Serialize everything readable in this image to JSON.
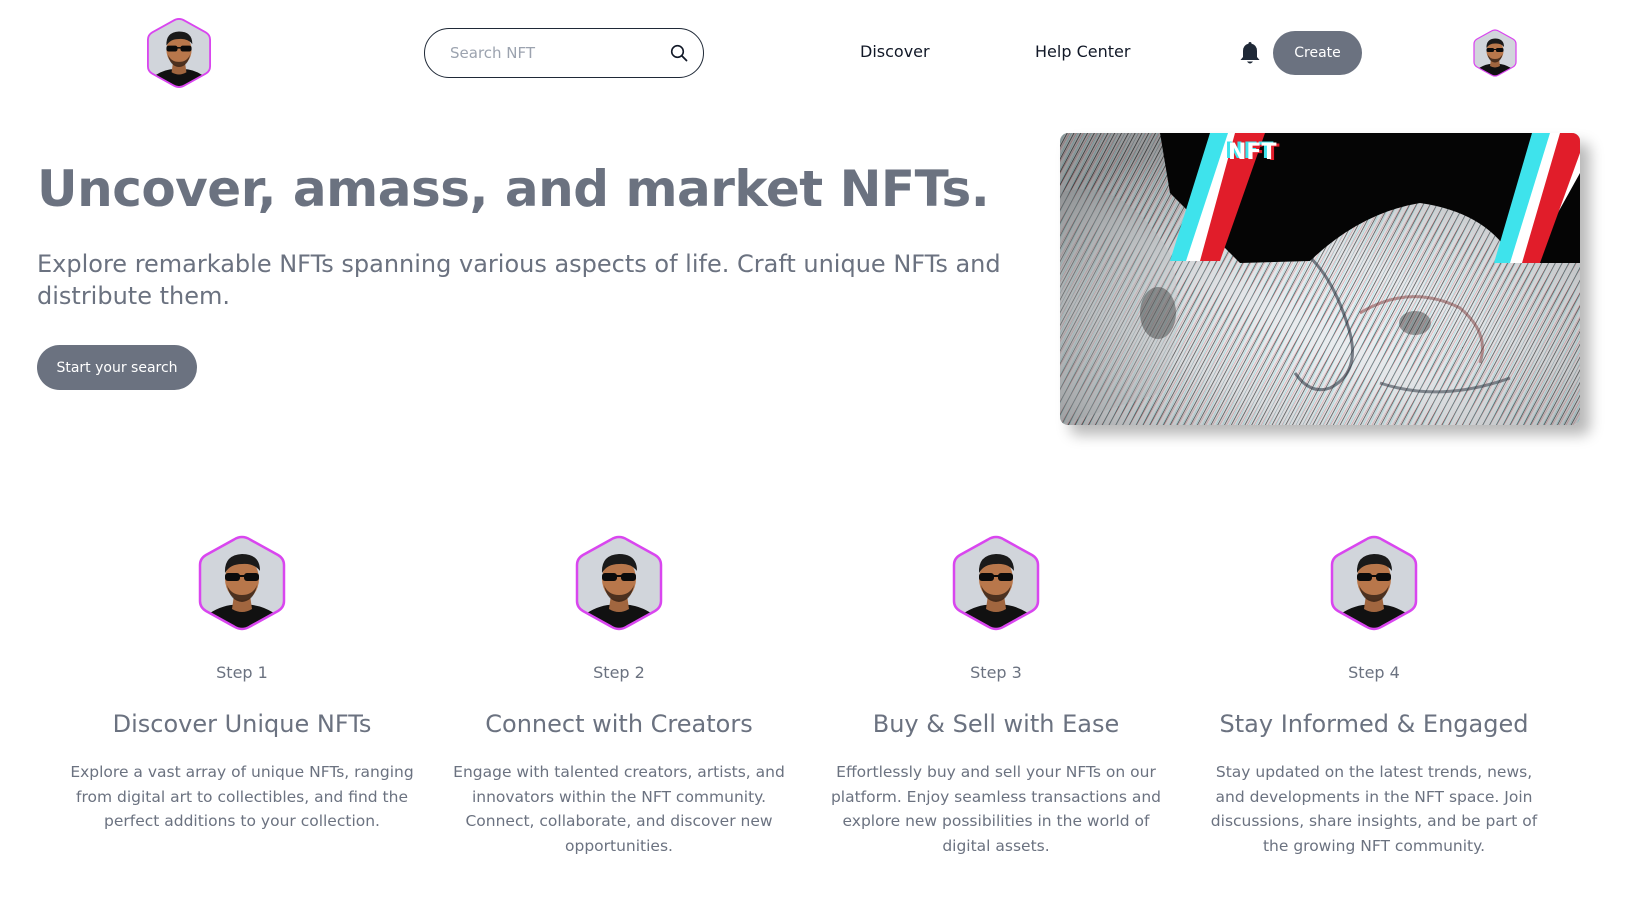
{
  "header": {
    "search": {
      "placeholder": "Search NFT",
      "value": ""
    },
    "nav": {
      "discover": "Discover",
      "help_center": "Help Center"
    },
    "create_label": "Create"
  },
  "hero": {
    "title": "Uncover, amass, and market NFTs.",
    "subtitle": "Explore remarkable NFTs spanning various aspects of life. Craft unique NFTs and distribute them.",
    "cta_label": "Start your search",
    "image_text": "NFT"
  },
  "steps": [
    {
      "label": "Step 1",
      "title": "Discover Unique NFTs",
      "description": "Explore a vast array of unique NFTs, ranging from digital art to collectibles, and find the perfect additions to your collection."
    },
    {
      "label": "Step 2",
      "title": "Connect with Creators",
      "description": "Engage with talented creators, artists, and innovators within the NFT community. Connect, collaborate, and discover new opportunities."
    },
    {
      "label": "Step 3",
      "title": "Buy & Sell with Ease",
      "description": "Effortlessly buy and sell your NFTs on our platform. Enjoy seamless transactions and explore new possibilities in the world of digital assets."
    },
    {
      "label": "Step 4",
      "title": "Stay Informed & Engaged",
      "description": "Stay updated on the latest trends, news, and developments in the NFT space. Join discussions, share insights, and be part of the growing NFT community."
    }
  ],
  "icons": {
    "logo": "hexagon-avatar-icon",
    "search": "search-icon",
    "bell": "bell-icon",
    "profile": "hexagon-avatar-icon"
  },
  "colors": {
    "accent_gray": "#6b7280",
    "hex_border": "#d946ef",
    "text_dark": "#111827"
  }
}
